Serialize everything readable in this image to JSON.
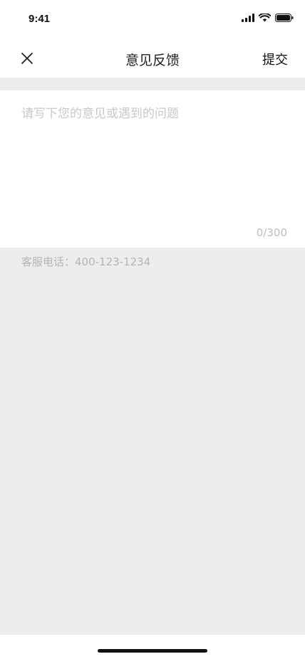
{
  "status_bar": {
    "time": "9:41",
    "signal_icon": "signal-bars-icon",
    "wifi_icon": "wifi-icon",
    "battery_icon": "battery-icon"
  },
  "nav": {
    "close_icon": "close-icon",
    "title": "意见反馈",
    "submit_label": "提交"
  },
  "feedback": {
    "placeholder": "请写下您的意见或遇到的问题",
    "value": "",
    "char_count": "0/300"
  },
  "service": {
    "phone_text": "客服电话：400-123-1234"
  },
  "colors": {
    "background": "#ededed",
    "surface": "#ffffff",
    "placeholder": "#c9c9c9",
    "muted_text": "#b5b5b5"
  }
}
